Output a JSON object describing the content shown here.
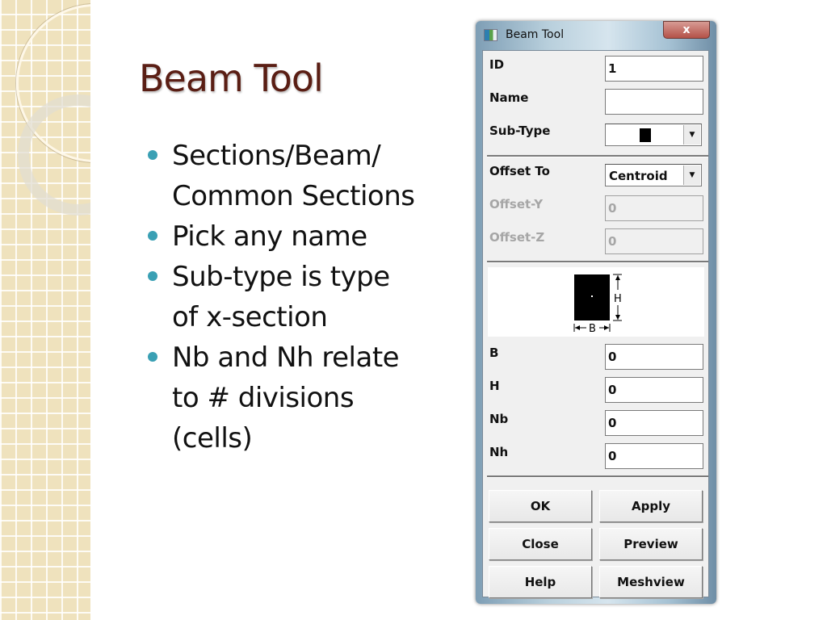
{
  "slide": {
    "title": "Beam Tool",
    "bullets": [
      "Sections/Beam/ Common Sections",
      "Pick any name",
      "Sub-type is type of x-section",
      "Nb and Nh relate to # divisions (cells)"
    ],
    "colors": {
      "title": "#5a1e14",
      "bullet": "#3aa0b4",
      "band": "#efe2bd"
    }
  },
  "dialog": {
    "title": "Beam Tool",
    "close_label": "x",
    "fields": {
      "id": {
        "label": "ID",
        "value": "1"
      },
      "name": {
        "label": "Name",
        "value": ""
      },
      "sub_type": {
        "label": "Sub-Type",
        "value": "solid-rectangle"
      },
      "offset_to": {
        "label": "Offset To",
        "value": "Centroid"
      },
      "offset_y": {
        "label": "Offset-Y",
        "value": "0"
      },
      "offset_z": {
        "label": "Offset-Z",
        "value": "0"
      },
      "b": {
        "label": "B",
        "value": "0"
      },
      "h": {
        "label": "H",
        "value": "0"
      },
      "nb": {
        "label": "Nb",
        "value": "0"
      },
      "nh": {
        "label": "Nh",
        "value": "0"
      }
    },
    "preview": {
      "dim_h": "H",
      "dim_b": "B"
    },
    "buttons": {
      "ok": "OK",
      "apply": "Apply",
      "close": "Close",
      "preview": "Preview",
      "help": "Help",
      "meshview": "Meshview"
    }
  }
}
